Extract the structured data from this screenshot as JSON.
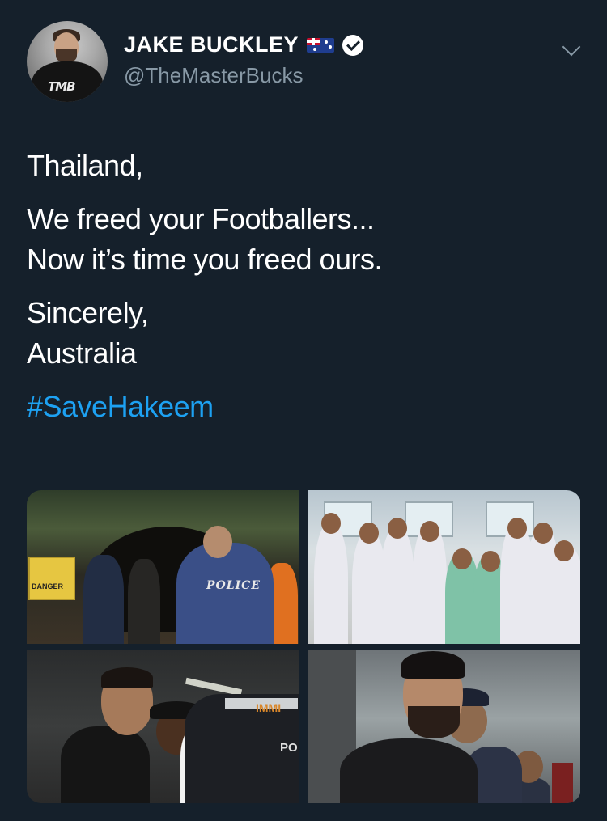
{
  "tweet": {
    "author": {
      "display_name": "JAKE BUCKLEY",
      "handle": "@TheMasterBucks",
      "avatar_logo": "TMB",
      "verified": true,
      "flag_emoji": "australia-flag"
    },
    "lines": {
      "greeting": "Thailand,",
      "line1": "We freed your Footballers...",
      "line2": "Now it’s time you freed ours.",
      "signoff": "Sincerely,",
      "signature": "Australia",
      "hashtag": "#SaveHakeem"
    },
    "media": {
      "image1_sign_text": "DANGER",
      "image1_vest_text": "POLICE",
      "image3_vest_text_top": "IMMI",
      "image3_vest_text_bottom": "PO"
    }
  },
  "colors": {
    "background": "#15202b",
    "hashtag": "#1da1f2",
    "secondary_text": "#8899a6"
  }
}
